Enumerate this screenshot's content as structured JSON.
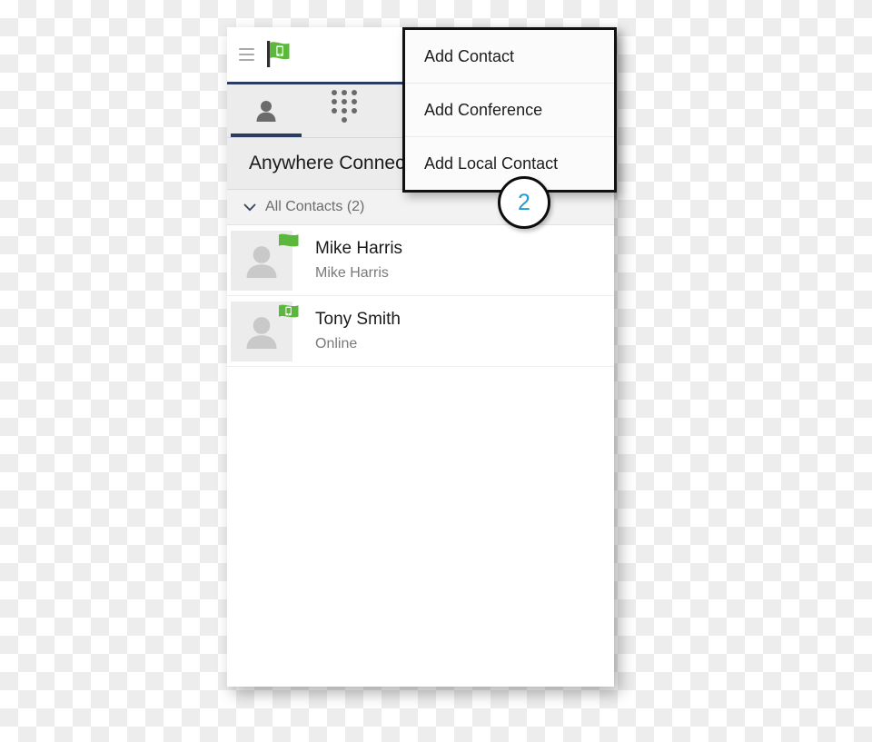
{
  "window": {
    "header": {
      "menu_icon": "hamburger-icon",
      "logo_icon": "green-flag-phone-logo"
    },
    "tabs": [
      {
        "id": "contacts",
        "icon": "person-icon",
        "active": true
      },
      {
        "id": "dialpad",
        "icon": "dialpad-icon",
        "active": false
      }
    ],
    "account": {
      "name": "Anywhere Connect"
    },
    "group": {
      "expand_icon": "chevron-down-icon",
      "label": "All Contacts (2)"
    },
    "contacts": [
      {
        "name": "Mike Harris",
        "status": "Mike Harris",
        "avatar_icon": "person-placeholder-icon",
        "badge_icon": "green-flag-icon"
      },
      {
        "name": "Tony Smith",
        "status": "Online",
        "avatar_icon": "person-placeholder-icon",
        "badge_icon": "green-flag-phone-icon"
      }
    ]
  },
  "dropdown": {
    "items": [
      {
        "label": "Add Contact"
      },
      {
        "label": "Add Conference"
      },
      {
        "label": "Add Local Contact"
      }
    ]
  },
  "callout": {
    "number": "2"
  },
  "colors": {
    "accent_navy": "#2a3c62",
    "brand_green": "#5cb83c",
    "callout_blue": "#1e9ad6",
    "tab_bg": "#ececec"
  }
}
